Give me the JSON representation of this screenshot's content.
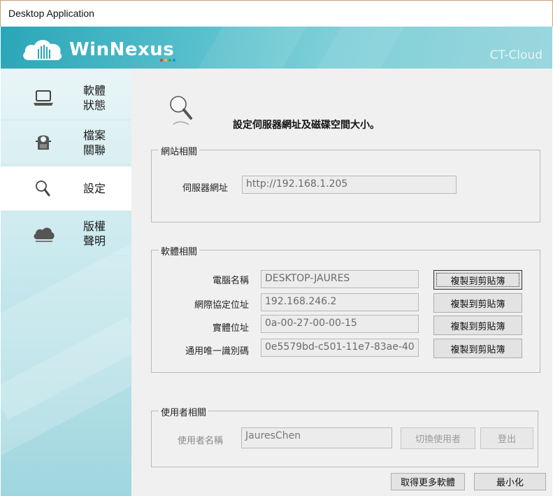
{
  "window": {
    "title": "Desktop Application"
  },
  "banner": {
    "logo_text": "WinNexus",
    "brand": "CT-Cloud",
    "logo_dot_colors": [
      "#e53935",
      "#fbc02d",
      "#43a047",
      "#1e88e5"
    ]
  },
  "sidebar": {
    "items": [
      {
        "label": "軟體狀態",
        "icon": "laptop-icon",
        "active": false
      },
      {
        "label": "檔案關聯",
        "icon": "file-association-icon",
        "active": false
      },
      {
        "label": "設定",
        "icon": "magnifier-icon",
        "active": true
      },
      {
        "label": "版權聲明",
        "icon": "cloud-icon",
        "active": false
      }
    ]
  },
  "page": {
    "icon": "magnifier-icon",
    "title": "設定伺服器網址及磁碟空間大小。"
  },
  "site_group": {
    "label": "網站相關",
    "server_url_label": "伺服器網址",
    "server_url_value": "http://192.168.1.205"
  },
  "software_group": {
    "label": "軟體相關",
    "rows": [
      {
        "label": "電腦名稱",
        "value": "DESKTOP-JAURES",
        "button": "複製到剪貼簿"
      },
      {
        "label": "網際協定位址",
        "value": "192.168.246.2",
        "button": "複製到剪貼簿"
      },
      {
        "label": "實體位址",
        "value": "0a-00-27-00-00-15",
        "button": "複製到剪貼簿"
      },
      {
        "label": "通用唯一識別碼",
        "value": "0e5579bd-c501-11e7-83ae-40",
        "button": "複製到剪貼簿"
      }
    ]
  },
  "user_group": {
    "label": "使用者相關",
    "username_label": "使用者名稱",
    "username_value": "JauresChen",
    "switch_user_button": "切換使用者",
    "logout_button": "登出"
  },
  "footer": {
    "more_software_button": "取得更多軟體",
    "minimize_button": "最小化"
  },
  "colors": {
    "banner_accent": "#2aa6b7",
    "sidebar_active": "#ffffff",
    "content_bg": "#f0f0f0"
  }
}
